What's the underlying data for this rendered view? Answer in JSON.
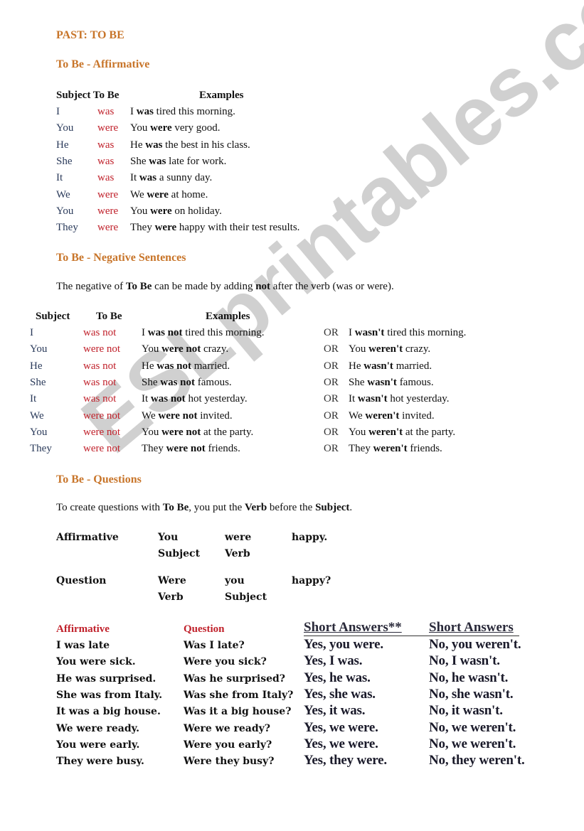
{
  "title": "PAST: TO BE",
  "affirmative": {
    "heading": "To Be - Affirmative",
    "headers": {
      "subject_tobe": "Subject To Be",
      "examples": "Examples"
    },
    "rows": [
      {
        "subject": "I",
        "verb": "was",
        "ex_pre": "I ",
        "ex_bold": "was",
        "ex_post": " tired this morning."
      },
      {
        "subject": "You",
        "verb": "were",
        "ex_pre": "You ",
        "ex_bold": "were",
        "ex_post": " very good."
      },
      {
        "subject": "He",
        "verb": "was",
        "ex_pre": "He ",
        "ex_bold": "was",
        "ex_post": " the best in his class."
      },
      {
        "subject": "She",
        "verb": "was",
        "ex_pre": "She ",
        "ex_bold": "was",
        "ex_post": " late for work."
      },
      {
        "subject": "It",
        "verb": "was",
        "ex_pre": "It ",
        "ex_bold": "was",
        "ex_post": " a sunny day."
      },
      {
        "subject": "We",
        "verb": "were",
        "ex_pre": "We ",
        "ex_bold": "were",
        "ex_post": " at home."
      },
      {
        "subject": "You",
        "verb": "were",
        "ex_pre": "You ",
        "ex_bold": "were",
        "ex_post": " on holiday."
      },
      {
        "subject": "They",
        "verb": "were",
        "ex_pre": "They ",
        "ex_bold": "were",
        "ex_post": " happy with their test results."
      }
    ]
  },
  "negative": {
    "heading": "To Be - Negative Sentences",
    "intro": {
      "p1": "The negative of ",
      "b1": "To Be",
      "p2": " can be made by adding ",
      "b2": "not",
      "p3": " after the verb (was or were)."
    },
    "headers": {
      "subject": "Subject",
      "tobe": "To Be",
      "examples": "Examples"
    },
    "or_label": "OR",
    "rows": [
      {
        "subject": "I",
        "verb": "was not",
        "ex_pre": "I ",
        "ex_bold": "was not",
        "ex_post": " tired this morning.",
        "alt_pre": "I ",
        "alt_bold": "wasn't",
        "alt_post": " tired this morning."
      },
      {
        "subject": "You",
        "verb": "were not",
        "ex_pre": "You ",
        "ex_bold": "were not",
        "ex_post": " crazy.",
        "alt_pre": "You ",
        "alt_bold": "weren't",
        "alt_post": " crazy."
      },
      {
        "subject": "He",
        "verb": "was not",
        "ex_pre": "He ",
        "ex_bold": "was not",
        "ex_post": " married.",
        "alt_pre": "He ",
        "alt_bold": "wasn't",
        "alt_post": " married."
      },
      {
        "subject": "She",
        "verb": "was not",
        "ex_pre": "She ",
        "ex_bold": "was not",
        "ex_post": " famous.",
        "alt_pre": "She ",
        "alt_bold": "wasn't",
        "alt_post": " famous."
      },
      {
        "subject": "It",
        "verb": "was not",
        "ex_pre": "It ",
        "ex_bold": "was not",
        "ex_post": " hot yesterday.",
        "alt_pre": "It ",
        "alt_bold": "wasn't",
        "alt_post": " hot yesterday."
      },
      {
        "subject": "We",
        "verb": "were not",
        "ex_pre": "We ",
        "ex_bold": "were not",
        "ex_post": " invited.",
        "alt_pre": "We ",
        "alt_bold": "weren't",
        "alt_post": " invited."
      },
      {
        "subject": "You",
        "verb": "were not",
        "ex_pre": "You ",
        "ex_bold": "were not",
        "ex_post": " at the party.",
        "alt_pre": "You ",
        "alt_bold": "weren't",
        "alt_post": " at the party."
      },
      {
        "subject": "They",
        "verb": "were not",
        "ex_pre": "They ",
        "ex_bold": "were not",
        "ex_post": " friends.",
        "alt_pre": "They ",
        "alt_bold": "weren't",
        "alt_post": " friends."
      }
    ]
  },
  "questions": {
    "heading": "To Be - Questions",
    "intro": {
      "p1": "To create questions with ",
      "b1": "To Be",
      "p2": ", you put the ",
      "b2": "Verb",
      "p3": " before the ",
      "b3": "Subject",
      "p4": "."
    },
    "structure": [
      {
        "label": "Affirmative",
        "w1": "You",
        "w1_sub": "Subject",
        "w2": "were",
        "w2_sub": "Verb",
        "w3": "happy."
      },
      {
        "label": "Question",
        "w1": "Were",
        "w1_sub": "Verb",
        "w2": "you",
        "w2_sub": "Subject",
        "w3": "happy?"
      }
    ],
    "table_headers": {
      "affirmative": "Affirmative",
      "question": "Question",
      "short_yes": "Short Answers**",
      "short_no": "Short Answers"
    },
    "rows": [
      {
        "aff": "I was late",
        "q": "Was I late?",
        "yes": "Yes, you were.",
        "no": "No, you weren't."
      },
      {
        "aff": "You were sick.",
        "q": "Were you sick?",
        "yes": "Yes, I was.",
        "no": "No, I wasn't."
      },
      {
        "aff": "He was surprised.",
        "q": "Was he surprised?",
        "yes": "Yes, he was.",
        "no": "No, he wasn't."
      },
      {
        "aff": "She was from Italy.",
        "q": "Was she from Italy?",
        "yes": "Yes, she was.",
        "no": "No, she wasn't."
      },
      {
        "aff": "It was a big house.",
        "q": "Was it a big house?",
        "yes": "Yes, it was.",
        "no": "No, it wasn't."
      },
      {
        "aff": "We were ready.",
        "q": "Were we ready?",
        "yes": "Yes, we were.",
        "no": "No, we weren't."
      },
      {
        "aff": "You were early.",
        "q": "Were you early?",
        "yes": "Yes, we were.",
        "no": "No, we weren't."
      },
      {
        "aff": "They were busy.",
        "q": "Were they busy?",
        "yes": "Yes, they were.",
        "no": "No, they weren't."
      }
    ]
  },
  "watermark": "ESLprintables.com",
  "colors": {
    "heading": "#c8752a",
    "verb_red": "#c0202a",
    "subject_blue": "#2a3a5a"
  }
}
